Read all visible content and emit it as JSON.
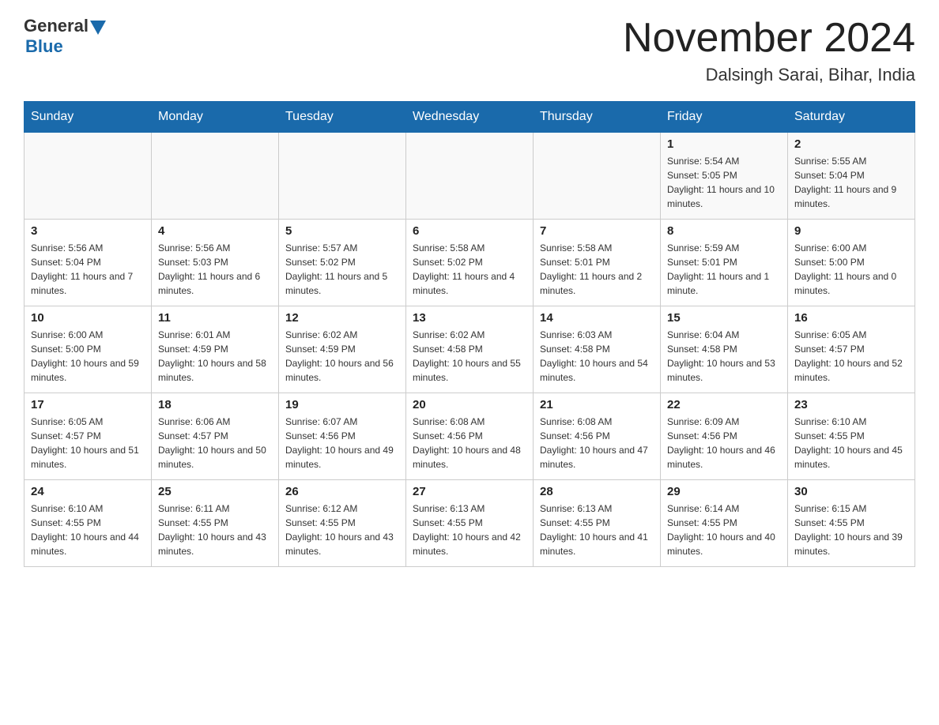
{
  "logo": {
    "general": "General",
    "blue": "Blue"
  },
  "header": {
    "month": "November 2024",
    "location": "Dalsingh Sarai, Bihar, India"
  },
  "weekdays": [
    "Sunday",
    "Monday",
    "Tuesday",
    "Wednesday",
    "Thursday",
    "Friday",
    "Saturday"
  ],
  "rows": [
    [
      {
        "day": "",
        "sunrise": "",
        "sunset": "",
        "daylight": ""
      },
      {
        "day": "",
        "sunrise": "",
        "sunset": "",
        "daylight": ""
      },
      {
        "day": "",
        "sunrise": "",
        "sunset": "",
        "daylight": ""
      },
      {
        "day": "",
        "sunrise": "",
        "sunset": "",
        "daylight": ""
      },
      {
        "day": "",
        "sunrise": "",
        "sunset": "",
        "daylight": ""
      },
      {
        "day": "1",
        "sunrise": "Sunrise: 5:54 AM",
        "sunset": "Sunset: 5:05 PM",
        "daylight": "Daylight: 11 hours and 10 minutes."
      },
      {
        "day": "2",
        "sunrise": "Sunrise: 5:55 AM",
        "sunset": "Sunset: 5:04 PM",
        "daylight": "Daylight: 11 hours and 9 minutes."
      }
    ],
    [
      {
        "day": "3",
        "sunrise": "Sunrise: 5:56 AM",
        "sunset": "Sunset: 5:04 PM",
        "daylight": "Daylight: 11 hours and 7 minutes."
      },
      {
        "day": "4",
        "sunrise": "Sunrise: 5:56 AM",
        "sunset": "Sunset: 5:03 PM",
        "daylight": "Daylight: 11 hours and 6 minutes."
      },
      {
        "day": "5",
        "sunrise": "Sunrise: 5:57 AM",
        "sunset": "Sunset: 5:02 PM",
        "daylight": "Daylight: 11 hours and 5 minutes."
      },
      {
        "day": "6",
        "sunrise": "Sunrise: 5:58 AM",
        "sunset": "Sunset: 5:02 PM",
        "daylight": "Daylight: 11 hours and 4 minutes."
      },
      {
        "day": "7",
        "sunrise": "Sunrise: 5:58 AM",
        "sunset": "Sunset: 5:01 PM",
        "daylight": "Daylight: 11 hours and 2 minutes."
      },
      {
        "day": "8",
        "sunrise": "Sunrise: 5:59 AM",
        "sunset": "Sunset: 5:01 PM",
        "daylight": "Daylight: 11 hours and 1 minute."
      },
      {
        "day": "9",
        "sunrise": "Sunrise: 6:00 AM",
        "sunset": "Sunset: 5:00 PM",
        "daylight": "Daylight: 11 hours and 0 minutes."
      }
    ],
    [
      {
        "day": "10",
        "sunrise": "Sunrise: 6:00 AM",
        "sunset": "Sunset: 5:00 PM",
        "daylight": "Daylight: 10 hours and 59 minutes."
      },
      {
        "day": "11",
        "sunrise": "Sunrise: 6:01 AM",
        "sunset": "Sunset: 4:59 PM",
        "daylight": "Daylight: 10 hours and 58 minutes."
      },
      {
        "day": "12",
        "sunrise": "Sunrise: 6:02 AM",
        "sunset": "Sunset: 4:59 PM",
        "daylight": "Daylight: 10 hours and 56 minutes."
      },
      {
        "day": "13",
        "sunrise": "Sunrise: 6:02 AM",
        "sunset": "Sunset: 4:58 PM",
        "daylight": "Daylight: 10 hours and 55 minutes."
      },
      {
        "day": "14",
        "sunrise": "Sunrise: 6:03 AM",
        "sunset": "Sunset: 4:58 PM",
        "daylight": "Daylight: 10 hours and 54 minutes."
      },
      {
        "day": "15",
        "sunrise": "Sunrise: 6:04 AM",
        "sunset": "Sunset: 4:58 PM",
        "daylight": "Daylight: 10 hours and 53 minutes."
      },
      {
        "day": "16",
        "sunrise": "Sunrise: 6:05 AM",
        "sunset": "Sunset: 4:57 PM",
        "daylight": "Daylight: 10 hours and 52 minutes."
      }
    ],
    [
      {
        "day": "17",
        "sunrise": "Sunrise: 6:05 AM",
        "sunset": "Sunset: 4:57 PM",
        "daylight": "Daylight: 10 hours and 51 minutes."
      },
      {
        "day": "18",
        "sunrise": "Sunrise: 6:06 AM",
        "sunset": "Sunset: 4:57 PM",
        "daylight": "Daylight: 10 hours and 50 minutes."
      },
      {
        "day": "19",
        "sunrise": "Sunrise: 6:07 AM",
        "sunset": "Sunset: 4:56 PM",
        "daylight": "Daylight: 10 hours and 49 minutes."
      },
      {
        "day": "20",
        "sunrise": "Sunrise: 6:08 AM",
        "sunset": "Sunset: 4:56 PM",
        "daylight": "Daylight: 10 hours and 48 minutes."
      },
      {
        "day": "21",
        "sunrise": "Sunrise: 6:08 AM",
        "sunset": "Sunset: 4:56 PM",
        "daylight": "Daylight: 10 hours and 47 minutes."
      },
      {
        "day": "22",
        "sunrise": "Sunrise: 6:09 AM",
        "sunset": "Sunset: 4:56 PM",
        "daylight": "Daylight: 10 hours and 46 minutes."
      },
      {
        "day": "23",
        "sunrise": "Sunrise: 6:10 AM",
        "sunset": "Sunset: 4:55 PM",
        "daylight": "Daylight: 10 hours and 45 minutes."
      }
    ],
    [
      {
        "day": "24",
        "sunrise": "Sunrise: 6:10 AM",
        "sunset": "Sunset: 4:55 PM",
        "daylight": "Daylight: 10 hours and 44 minutes."
      },
      {
        "day": "25",
        "sunrise": "Sunrise: 6:11 AM",
        "sunset": "Sunset: 4:55 PM",
        "daylight": "Daylight: 10 hours and 43 minutes."
      },
      {
        "day": "26",
        "sunrise": "Sunrise: 6:12 AM",
        "sunset": "Sunset: 4:55 PM",
        "daylight": "Daylight: 10 hours and 43 minutes."
      },
      {
        "day": "27",
        "sunrise": "Sunrise: 6:13 AM",
        "sunset": "Sunset: 4:55 PM",
        "daylight": "Daylight: 10 hours and 42 minutes."
      },
      {
        "day": "28",
        "sunrise": "Sunrise: 6:13 AM",
        "sunset": "Sunset: 4:55 PM",
        "daylight": "Daylight: 10 hours and 41 minutes."
      },
      {
        "day": "29",
        "sunrise": "Sunrise: 6:14 AM",
        "sunset": "Sunset: 4:55 PM",
        "daylight": "Daylight: 10 hours and 40 minutes."
      },
      {
        "day": "30",
        "sunrise": "Sunrise: 6:15 AM",
        "sunset": "Sunset: 4:55 PM",
        "daylight": "Daylight: 10 hours and 39 minutes."
      }
    ]
  ]
}
